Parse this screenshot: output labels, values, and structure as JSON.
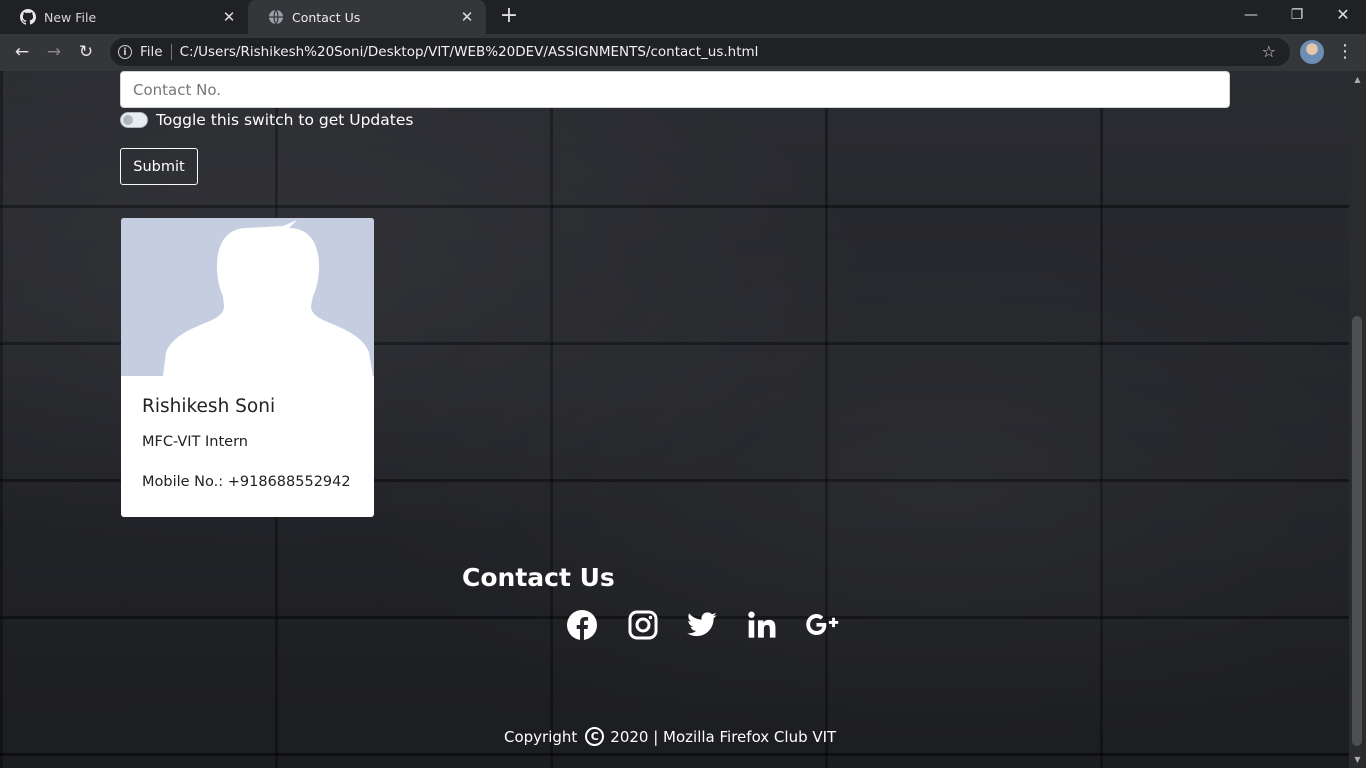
{
  "browser": {
    "tabs": [
      {
        "title": "New File",
        "active": false,
        "favicon": "github-icon"
      },
      {
        "title": "Contact Us",
        "active": true,
        "favicon": "globe-icon"
      }
    ],
    "address": {
      "scheme": "File",
      "url": "C:/Users/Rishikesh%20Soni/Desktop/VIT/WEB%20DEV/ASSIGNMENTS/contact_us.html"
    }
  },
  "form": {
    "contact_placeholder": "Contact No.",
    "contact_value": "",
    "toggle_label": "Toggle this switch to get Updates",
    "toggle_on": false,
    "submit_label": "Submit"
  },
  "card": {
    "name": "Rishikesh Soni",
    "role": "MFC-VIT Intern",
    "mobile": "Mobile No.: +918688552942",
    "image": "person-placeholder-icon"
  },
  "footer": {
    "title": "Contact Us",
    "social": [
      "facebook-icon",
      "instagram-icon",
      "twitter-icon",
      "linkedin-icon",
      "google-plus-icon"
    ],
    "copyright_prefix": "Copyright",
    "copyright_suffix": "2020 | Mozilla Firefox Club VIT"
  },
  "colors": {
    "page_background": "#1f2024",
    "card_image_background": "#c5cee0",
    "chrome_dark": "#202124",
    "chrome_toolbar": "#35363a"
  }
}
